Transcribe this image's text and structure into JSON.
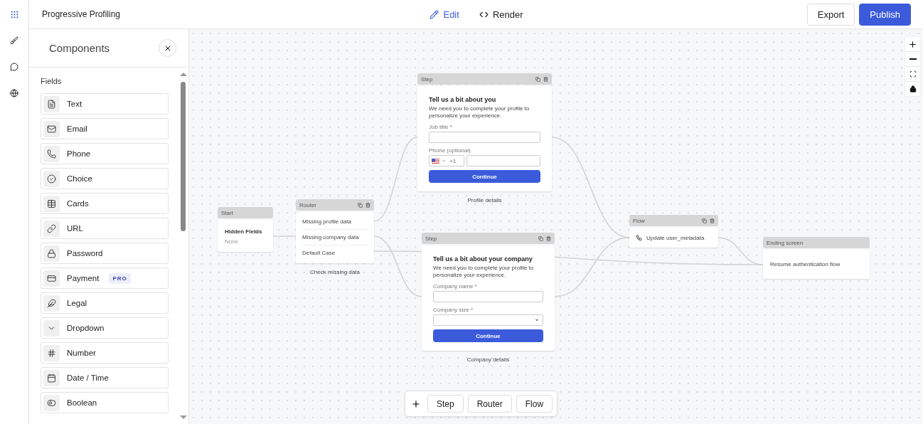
{
  "app_title": "Progressive Profiling",
  "rail_items": [
    {
      "kind": "grid",
      "selected": true
    },
    {
      "kind": "brush",
      "selected": false
    },
    {
      "kind": "comment",
      "selected": false
    },
    {
      "kind": "globe",
      "selected": false
    }
  ],
  "tabs": [
    {
      "label": "Edit",
      "kind": "edit",
      "selected": true
    },
    {
      "label": "Render",
      "kind": "code",
      "selected": false
    }
  ],
  "actions": [
    {
      "label": "Export",
      "kind": "secondary"
    },
    {
      "label": "Publish",
      "kind": "primary"
    }
  ],
  "components_panel": {
    "title": "Components",
    "section": "Fields",
    "items": [
      {
        "label": "Text",
        "kind": "text"
      },
      {
        "label": "Email",
        "kind": "email"
      },
      {
        "label": "Phone",
        "kind": "phone"
      },
      {
        "label": "Choice",
        "kind": "choice"
      },
      {
        "label": "Cards",
        "kind": "cards"
      },
      {
        "label": "URL",
        "kind": "url"
      },
      {
        "label": "Password",
        "kind": "password"
      },
      {
        "label": "Payment",
        "kind": "payment",
        "badge": "PRO"
      },
      {
        "label": "Legal",
        "kind": "legal"
      },
      {
        "label": "Dropdown",
        "kind": "dropdown"
      },
      {
        "label": "Number",
        "kind": "number"
      },
      {
        "label": "Date / Time",
        "kind": "date"
      },
      {
        "label": "Boolean",
        "kind": "boolean"
      }
    ]
  },
  "nodes": [
    {
      "kind": "start",
      "header": "Start",
      "title": "Hidden Fields",
      "value": "None"
    },
    {
      "kind": "router",
      "header": "Router",
      "rows": [
        "Missing profile data",
        "Missing company data",
        "Default Case"
      ],
      "caption": "Check missing data"
    },
    {
      "kind": "step",
      "header": "Step",
      "title": "Tell us a bit about you",
      "description": "We need you to complete your profile to personalize your experience.",
      "fields": [
        {
          "kind": "text",
          "label": "Job title *"
        },
        {
          "kind": "phone",
          "label": "Phone (optional)",
          "code": "+1"
        }
      ],
      "button": "Continue",
      "caption": "Profile details"
    },
    {
      "kind": "step",
      "header": "Step",
      "title": "Tell us a bit about your company",
      "description": "We need you to complete your profile to personalize your experience.",
      "fields": [
        {
          "kind": "text",
          "label": "Company name *"
        },
        {
          "kind": "select",
          "label": "Company size *"
        }
      ],
      "button": "Continue",
      "caption": "Company details"
    },
    {
      "kind": "flow",
      "header": "Flow",
      "action": "Update user_metadata"
    },
    {
      "kind": "ending",
      "header": "Ending screen",
      "action": "Resume authentication flow"
    }
  ],
  "toolbar": {
    "items": [
      "Step",
      "Router",
      "Flow"
    ]
  }
}
